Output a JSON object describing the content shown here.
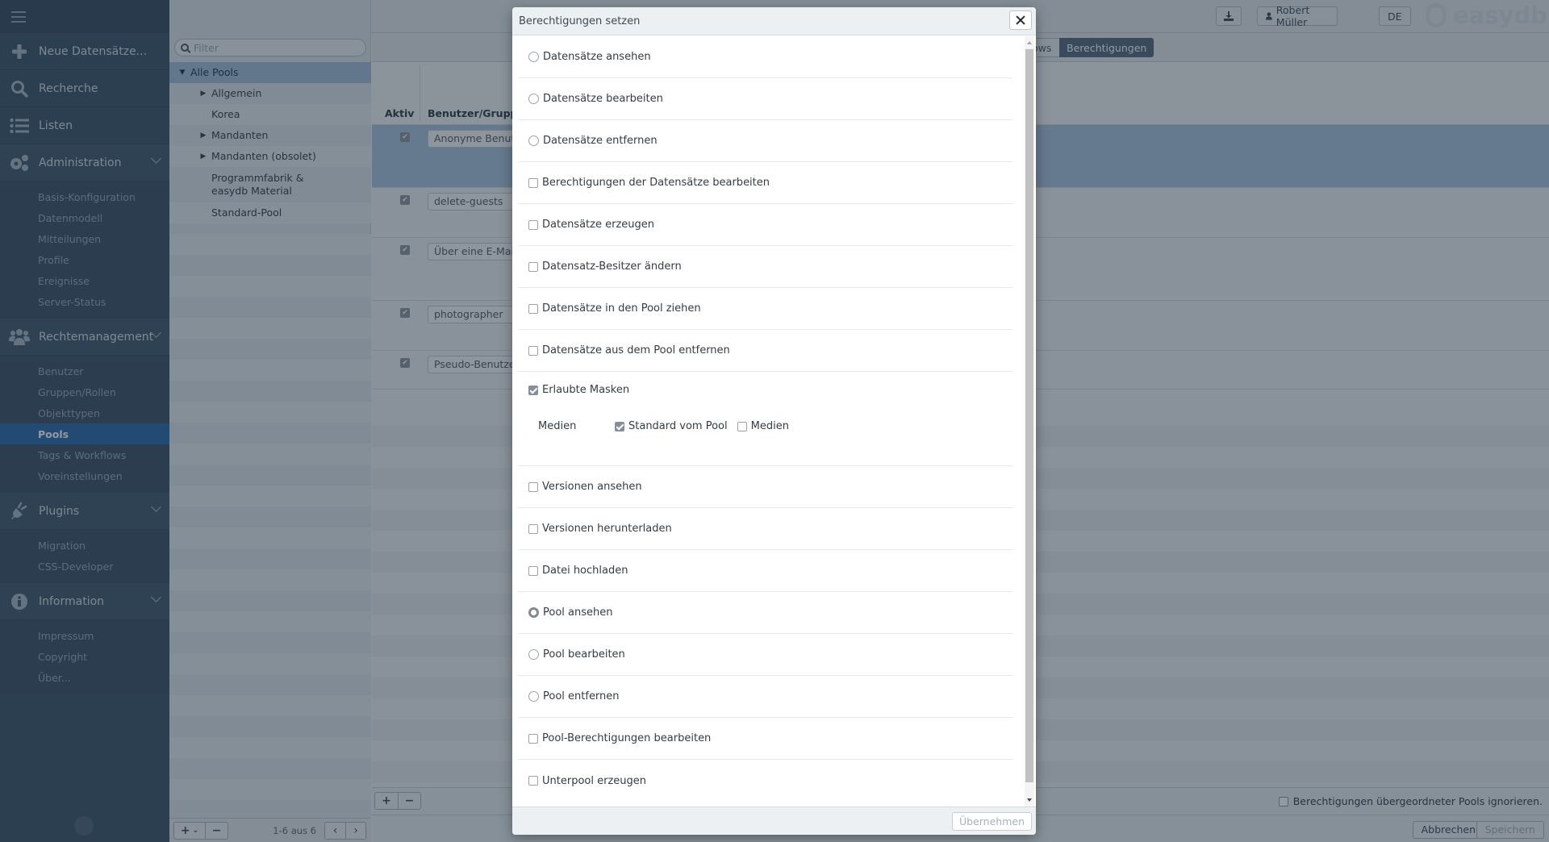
{
  "app": {
    "brand": "easydb",
    "page_title": "Pools"
  },
  "header": {
    "download_icon": "download-icon",
    "user_name": "Robert Müller",
    "language": "DE"
  },
  "sidebar": {
    "main_items": [
      {
        "label": "Neue Datensätze...",
        "icon": "plus-icon"
      },
      {
        "label": "Recherche",
        "icon": "search-icon"
      },
      {
        "label": "Listen",
        "icon": "list-icon"
      }
    ],
    "sections": [
      {
        "label": "Administration",
        "icon": "gears-icon",
        "items": [
          "Basis-Konfiguration",
          "Datenmodell",
          "Mitteilungen",
          "Profile",
          "Ereignisse",
          "Server-Status"
        ]
      },
      {
        "label": "Rechtemanagement",
        "icon": "users-icon",
        "items": [
          "Benutzer",
          "Gruppen/Rollen",
          "Objekttypen",
          "Pools",
          "Tags & Workflows",
          "Voreinstellungen"
        ],
        "active": "Pools"
      },
      {
        "label": "Plugins",
        "icon": "plug-icon",
        "items": [
          "Migration",
          "CSS-Developer"
        ]
      },
      {
        "label": "Information",
        "icon": "info-icon",
        "items": [
          "Impressum",
          "Copyright",
          "Über..."
        ]
      }
    ]
  },
  "pools": {
    "filter_placeholder": "Filter",
    "tree": [
      {
        "label": "Alle Pools",
        "level": 0,
        "expanded": true,
        "selected": true
      },
      {
        "label": "Allgemein",
        "level": 1,
        "has_children": true
      },
      {
        "label": "Korea",
        "level": 1,
        "has_children": false
      },
      {
        "label": "Mandanten",
        "level": 1,
        "has_children": true
      },
      {
        "label": "Mandanten (obsolet)",
        "level": 1,
        "has_children": true
      },
      {
        "label": "Programmfabrik & easydb Material",
        "level": 1,
        "has_children": false
      },
      {
        "label": "Standard-Pool",
        "level": 1,
        "has_children": false
      }
    ],
    "pager": "1-6 aus 6"
  },
  "main": {
    "tabs": [
      {
        "label": "ows",
        "active": false
      },
      {
        "label": "Berechtigungen",
        "active": true
      }
    ],
    "table": {
      "headers": {
        "aktiv": "Aktiv",
        "user": "Benutzer/Gruppe"
      },
      "rows": [
        {
          "active": true,
          "user": "Anonyme Benutzer",
          "selected": true
        },
        {
          "active": true,
          "user": "delete-guests"
        },
        {
          "active": true,
          "user": "Über eine E-Mail"
        },
        {
          "active": true,
          "user": "photographer"
        },
        {
          "active": true,
          "user": "Pseudo-Benutzer"
        }
      ]
    },
    "ignore_parent_label": "Berechtigungen übergeordneter Pools ignorieren.",
    "cancel_label": "Abbrechen",
    "save_label": "Speichern"
  },
  "modal": {
    "title": "Berechtigungen setzen",
    "permissions": [
      {
        "label": "Datensätze ansehen",
        "type": "radio",
        "checked": false
      },
      {
        "label": "Datensätze bearbeiten",
        "type": "radio",
        "checked": false
      },
      {
        "label": "Datensätze entfernen",
        "type": "radio",
        "checked": false
      },
      {
        "label": "Berechtigungen der Datensätze bearbeiten",
        "type": "checkbox",
        "checked": false
      },
      {
        "label": "Datensätze erzeugen",
        "type": "checkbox",
        "checked": false
      },
      {
        "label": "Datensatz-Besitzer ändern",
        "type": "checkbox",
        "checked": false
      },
      {
        "label": "Datensätze in den Pool ziehen",
        "type": "checkbox",
        "checked": false
      },
      {
        "label": "Datensätze aus dem Pool entfernen",
        "type": "checkbox",
        "checked": false
      },
      {
        "label": "Erlaubte Masken",
        "type": "checkbox",
        "checked": true
      },
      {
        "label": "Versionen ansehen",
        "type": "checkbox",
        "checked": false
      },
      {
        "label": "Versionen herunterladen",
        "type": "checkbox",
        "checked": false
      },
      {
        "label": "Datei hochladen",
        "type": "checkbox",
        "checked": false
      },
      {
        "label": "Pool ansehen",
        "type": "radio",
        "checked": true
      },
      {
        "label": "Pool bearbeiten",
        "type": "radio",
        "checked": false
      },
      {
        "label": "Pool entfernen",
        "type": "radio",
        "checked": false
      },
      {
        "label": "Pool-Berechtigungen bearbeiten",
        "type": "checkbox",
        "checked": false
      },
      {
        "label": "Unterpool erzeugen",
        "type": "checkbox",
        "checked": false
      }
    ],
    "masks": {
      "objecttype": "Medien",
      "options": [
        {
          "label": "Standard vom Pool",
          "checked": true
        },
        {
          "label": "Medien",
          "checked": false
        }
      ]
    },
    "apply_label": "Übernehmen"
  }
}
